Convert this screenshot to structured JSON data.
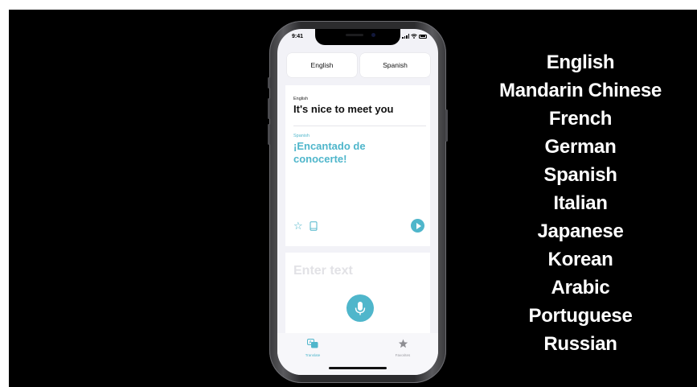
{
  "phone": {
    "status_time": "9:41",
    "language_pair": {
      "source_button": "English",
      "target_button": "Spanish"
    },
    "translation_card": {
      "source_language": "English",
      "source_text": "It's nice to meet you",
      "target_language": "Spanish",
      "target_text": "¡Encantado de conocerte!",
      "actions": [
        "star-icon",
        "book-icon",
        "play-icon"
      ]
    },
    "input": {
      "placeholder": "Enter text",
      "mic_icon": "microphone-icon"
    },
    "tabs": [
      {
        "label": "Translate",
        "icon": "translate-icon",
        "active": true
      },
      {
        "label": "Favorites",
        "icon": "star-icon",
        "active": false
      }
    ]
  },
  "supported_languages": [
    "English",
    "Mandarin Chinese",
    "French",
    "German",
    "Spanish",
    "Italian",
    "Japanese",
    "Korean",
    "Arabic",
    "Portuguese",
    "Russian"
  ],
  "colors": {
    "background": "#000000",
    "accent": "#4fb6cb",
    "text_light": "#ffffff",
    "inactive": "#9a9aa0"
  }
}
